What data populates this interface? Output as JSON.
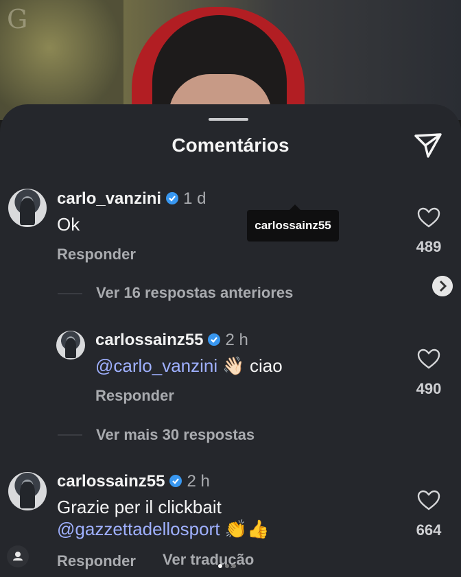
{
  "sheet": {
    "title": "Comentários"
  },
  "tooltip": {
    "text": "carlossainz55"
  },
  "photo": {
    "glyph": "G"
  },
  "comments": [
    {
      "user": "carlo_vanzini",
      "time": "1 d",
      "text": "Ok",
      "reply": "Responder",
      "likes": "489"
    },
    {
      "user": "carlossainz55",
      "time": "2 h",
      "mention": "@carlo_vanzini",
      "emoji": "👋🏻",
      "text": "ciao",
      "reply": "Responder",
      "likes": "490"
    },
    {
      "user": "carlossainz55",
      "time": "2 h",
      "text": "Grazie per il clickbait",
      "mention": "@gazzettadellosport",
      "emoji": "👏👍",
      "reply": "Responder",
      "translate": "Ver tradução",
      "likes": "664"
    }
  ],
  "threads": {
    "previous": "Ver 16 respostas anteriores",
    "more": "Ver mais 30 respostas"
  },
  "colors": {
    "background": "#25272c",
    "mention": "#9fb0ff",
    "verified": "#3897f0"
  }
}
